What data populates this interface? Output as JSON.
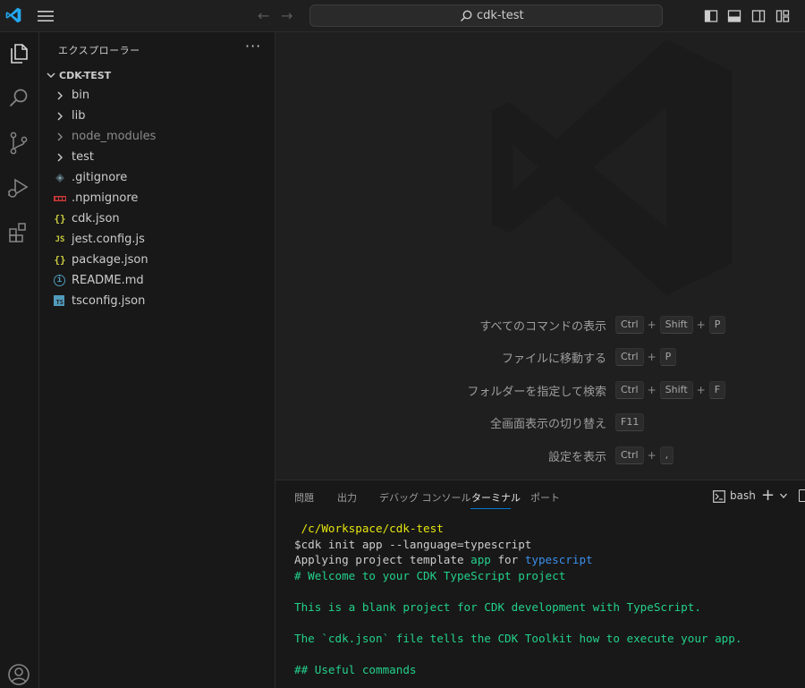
{
  "titlebar": {
    "search_text": "cdk-test"
  },
  "sidebar": {
    "title": "エクスプローラー",
    "more": "···",
    "root_label": "CDK-TEST",
    "items": [
      {
        "label": "bin",
        "kind": "folder",
        "icon": "chevron-right-icon"
      },
      {
        "label": "lib",
        "kind": "folder",
        "icon": "chevron-right-icon"
      },
      {
        "label": "node_modules",
        "kind": "folder",
        "icon": "chevron-right-icon",
        "dim": true
      },
      {
        "label": "test",
        "kind": "folder",
        "icon": "chevron-right-icon"
      },
      {
        "label": ".gitignore",
        "kind": "file",
        "icon": "git-icon"
      },
      {
        "label": ".npmignore",
        "kind": "file",
        "icon": "npm-icon"
      },
      {
        "label": "cdk.json",
        "kind": "file",
        "icon": "json-icon",
        "glyph": "{}"
      },
      {
        "label": "jest.config.js",
        "kind": "file",
        "icon": "javascript-icon",
        "glyph": "JS"
      },
      {
        "label": "package.json",
        "kind": "file",
        "icon": "json-icon",
        "glyph": "{}"
      },
      {
        "label": "README.md",
        "kind": "file",
        "icon": "info-icon",
        "glyph": "i"
      },
      {
        "label": "tsconfig.json",
        "kind": "file",
        "icon": "typescript-icon",
        "glyph": "TS"
      }
    ]
  },
  "editor": {
    "shortcuts": [
      {
        "label": "すべてのコマンドの表示",
        "keys": [
          "Ctrl",
          "Shift",
          "P"
        ]
      },
      {
        "label": "ファイルに移動する",
        "keys": [
          "Ctrl",
          "P"
        ]
      },
      {
        "label": "フォルダーを指定して検索",
        "keys": [
          "Ctrl",
          "Shift",
          "F"
        ]
      },
      {
        "label": "全画面表示の切り替え",
        "keys": [
          "F11"
        ]
      },
      {
        "label": "設定を表示",
        "keys": [
          "Ctrl",
          ","
        ]
      }
    ],
    "key_separator": "+"
  },
  "panel": {
    "tabs": [
      {
        "label": "問題",
        "active": false
      },
      {
        "label": "出力",
        "active": false
      },
      {
        "label": "デバッグ コンソール",
        "active": false
      },
      {
        "label": "ターミナル",
        "active": true
      },
      {
        "label": "ポート",
        "active": false
      }
    ],
    "shell_label": "bash",
    "terminal": {
      "cwd": " /c/Workspace/cdk-test",
      "command": "$cdk init app --language=typescript",
      "applying_prefix": "Applying project template ",
      "applying_app": "app",
      "applying_for": " for ",
      "applying_lang": "typescript",
      "lines_green": [
        "# Welcome to your CDK TypeScript project",
        "",
        "This is a blank project for CDK development with TypeScript.",
        "",
        "The `cdk.json` file tells the CDK Toolkit how to execute your app.",
        "",
        "## Useful commands"
      ]
    }
  },
  "colors": {
    "accent": "#0078d4",
    "vscode_blue": "#23a9f2",
    "terminal_yellow": "#e5e510",
    "terminal_green": "#23d18b",
    "terminal_blue": "#3b8eea"
  }
}
